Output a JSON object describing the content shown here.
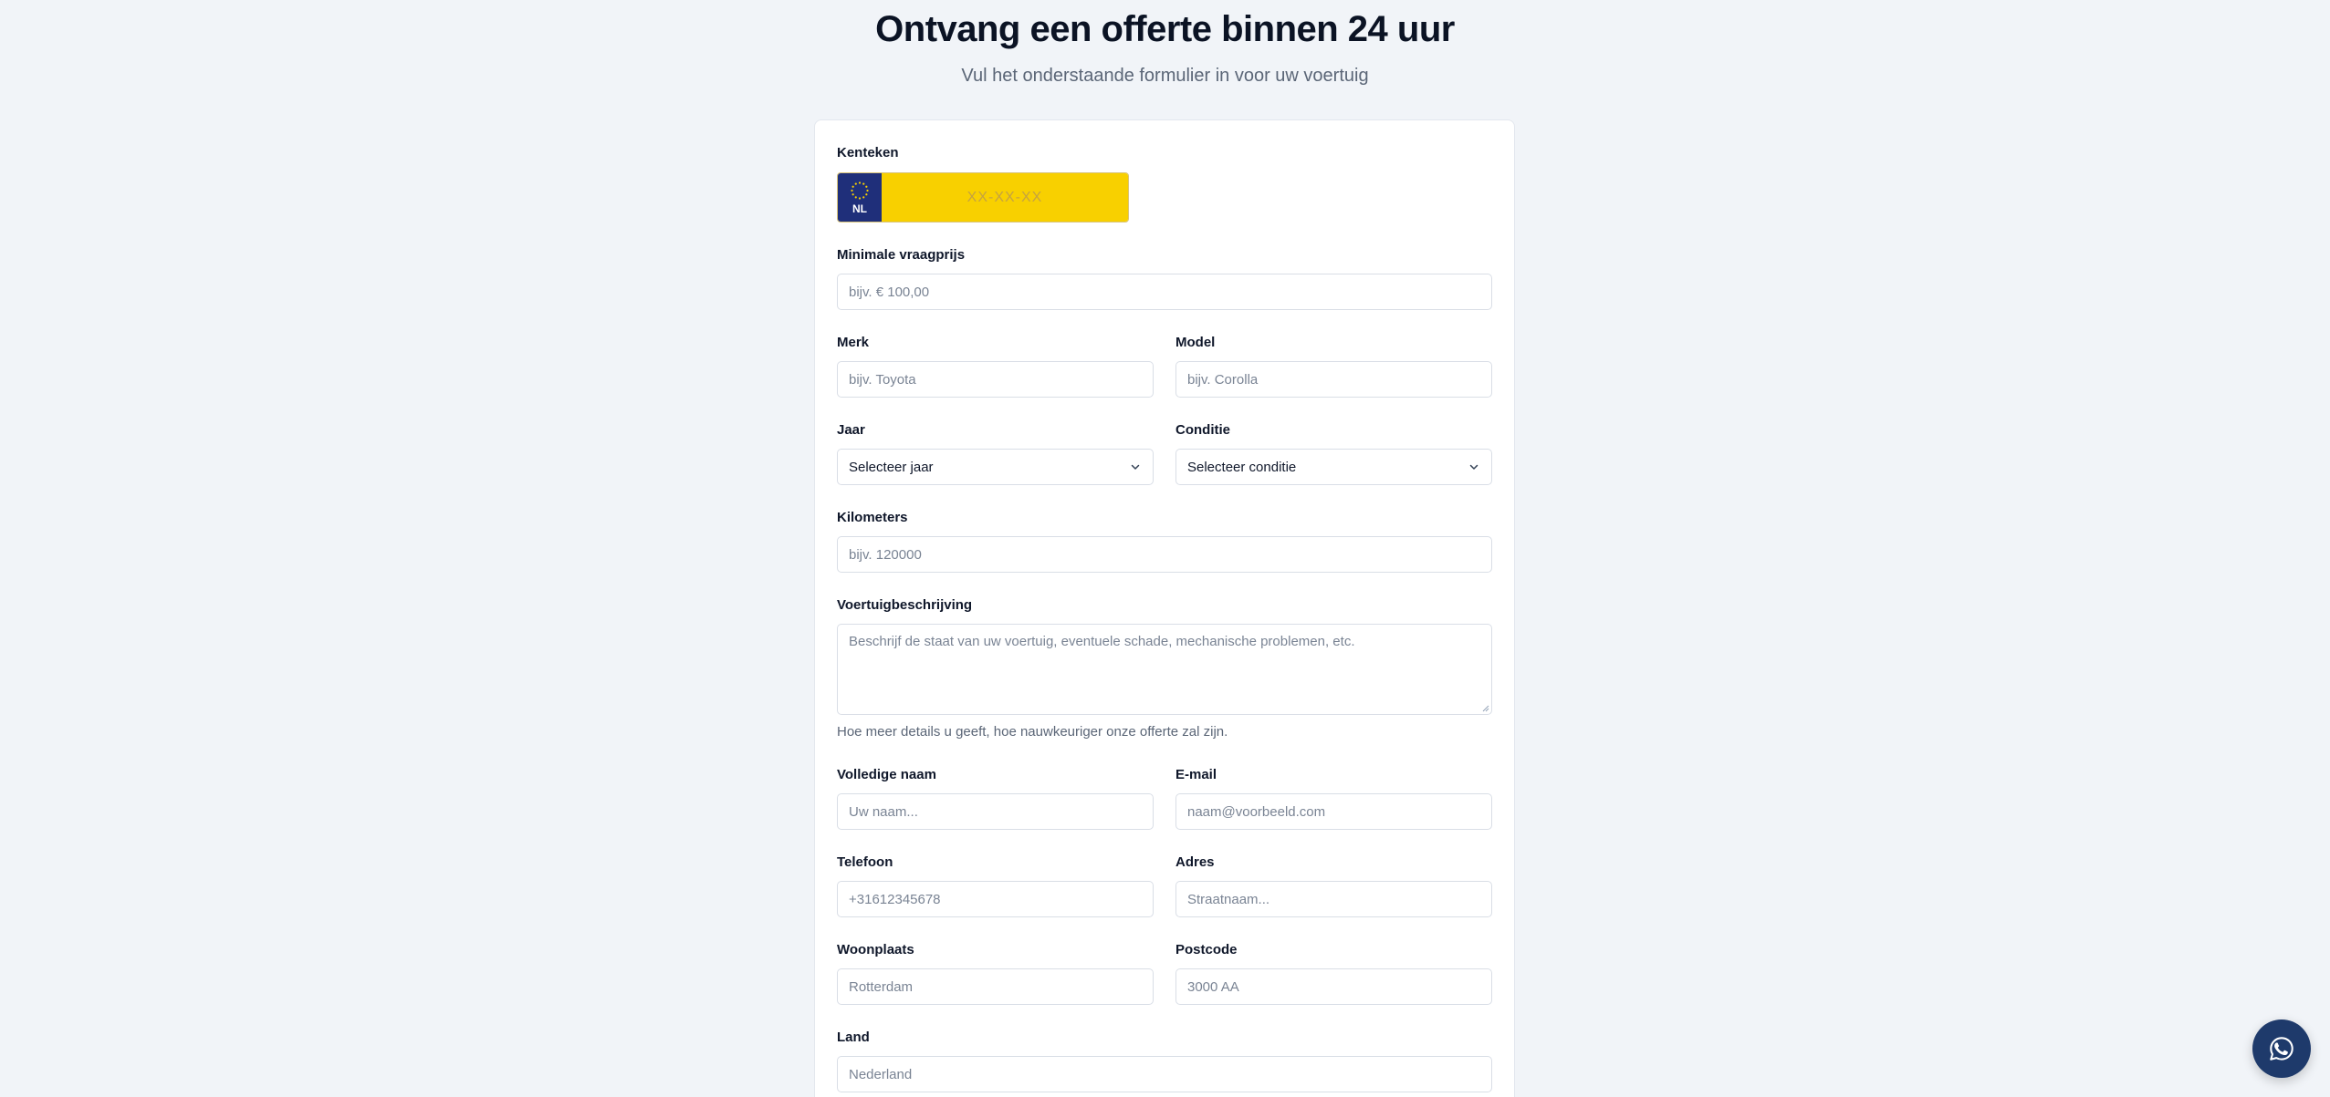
{
  "header": {
    "title": "Ontvang een offerte binnen 24 uur",
    "subtitle": "Vul het onderstaande formulier in voor uw voertuig"
  },
  "form": {
    "license_plate": {
      "label": "Kenteken",
      "country_code": "NL",
      "placeholder": "XX-XX-XX"
    },
    "min_price": {
      "label": "Minimale vraagprijs",
      "placeholder": "bijv. € 100,00"
    },
    "brand": {
      "label": "Merk",
      "placeholder": "bijv. Toyota"
    },
    "model": {
      "label": "Model",
      "placeholder": "bijv. Corolla"
    },
    "year": {
      "label": "Jaar",
      "selected": "Selecteer jaar"
    },
    "condition": {
      "label": "Conditie",
      "selected": "Selecteer conditie"
    },
    "kilometers": {
      "label": "Kilometers",
      "placeholder": "bijv. 120000"
    },
    "description": {
      "label": "Voertuigbeschrijving",
      "placeholder": "Beschrijf de staat van uw voertuig, eventuele schade, mechanische problemen, etc.",
      "helper": "Hoe meer details u geeft, hoe nauwkeuriger onze offerte zal zijn."
    },
    "full_name": {
      "label": "Volledige naam",
      "placeholder": "Uw naam..."
    },
    "email": {
      "label": "E-mail",
      "placeholder": "naam@voorbeeld.com"
    },
    "phone": {
      "label": "Telefoon",
      "placeholder": "+31612345678"
    },
    "address": {
      "label": "Adres",
      "placeholder": "Straatnaam..."
    },
    "city": {
      "label": "Woonplaats",
      "placeholder": "Rotterdam"
    },
    "postal_code": {
      "label": "Postcode",
      "placeholder": "3000 AA"
    },
    "country": {
      "label": "Land",
      "placeholder": "Nederland"
    }
  },
  "icons": {
    "chevron": "chevron-down-icon",
    "whatsapp": "whatsapp-icon",
    "eu_stars": "eu-stars-icon"
  },
  "colors": {
    "plate_yellow": "#f8d000",
    "plate_blue": "#1f2f7a",
    "whatsapp_bg": "#1e3a6b",
    "page_bg": "#f1f4f8"
  }
}
